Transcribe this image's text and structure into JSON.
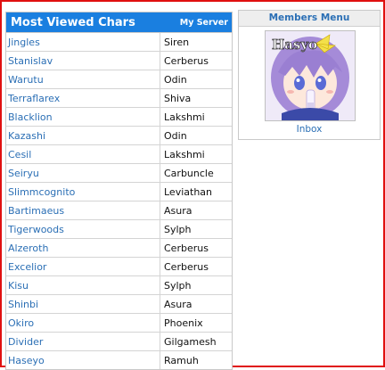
{
  "most_viewed": {
    "title": "Most Viewed Chars",
    "server_link": "My Server",
    "rows": [
      {
        "name": "Jingles",
        "server": "Siren"
      },
      {
        "name": "Stanislav",
        "server": "Cerberus"
      },
      {
        "name": "Warutu",
        "server": "Odin"
      },
      {
        "name": "Terraflarex",
        "server": "Shiva"
      },
      {
        "name": "Blacklion",
        "server": "Lakshmi"
      },
      {
        "name": "Kazashi",
        "server": "Odin"
      },
      {
        "name": "Cesil",
        "server": "Lakshmi"
      },
      {
        "name": "Seiryu",
        "server": "Carbuncle"
      },
      {
        "name": "Slimmcognito",
        "server": "Leviathan"
      },
      {
        "name": "Bartimaeus",
        "server": "Asura"
      },
      {
        "name": "Tigerwoods",
        "server": "Sylph"
      },
      {
        "name": "Alzeroth",
        "server": "Cerberus"
      },
      {
        "name": "Excelior",
        "server": "Cerberus"
      },
      {
        "name": "Kisu",
        "server": "Sylph"
      },
      {
        "name": "Shinbi",
        "server": "Asura"
      },
      {
        "name": "Okiro",
        "server": "Phoenix"
      },
      {
        "name": "Divider",
        "server": "Gilgamesh"
      },
      {
        "name": "Haseyo",
        "server": "Ramuh"
      }
    ]
  },
  "members_menu": {
    "title": "Members Menu",
    "avatar_text": "Hasyo",
    "inbox_label": "Inbox"
  },
  "colors": {
    "header_blue": "#1a7fe0",
    "link_blue": "#2b6fb5",
    "frame_red": "#e01010",
    "avatar_hair": "#a58bd8"
  }
}
